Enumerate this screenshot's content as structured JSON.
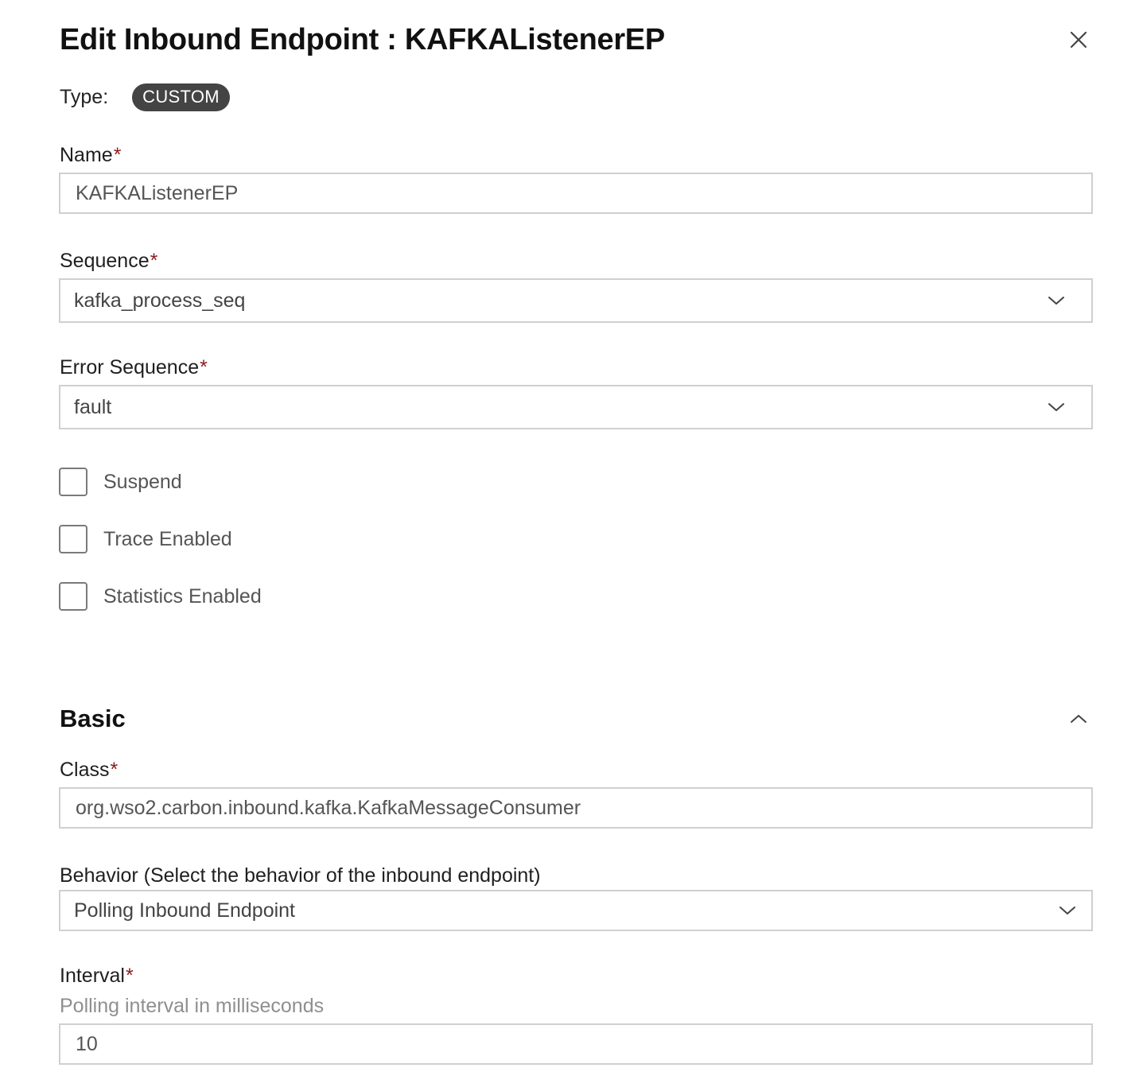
{
  "dialog": {
    "title": "Edit Inbound Endpoint : KAFKAListenerEP",
    "close_icon": "close-icon"
  },
  "type": {
    "label": "Type:",
    "value": "CUSTOM"
  },
  "fields": {
    "name": {
      "label": "Name",
      "required_mark": "*",
      "value": "KAFKAListenerEP"
    },
    "sequence": {
      "label": "Sequence",
      "required_mark": "*",
      "value": "kafka_process_seq"
    },
    "error_sequence": {
      "label": "Error Sequence",
      "required_mark": "*",
      "value": "fault"
    }
  },
  "checkboxes": {
    "suspend": {
      "label": "Suspend",
      "checked": false
    },
    "trace": {
      "label": "Trace Enabled",
      "checked": false
    },
    "statistics": {
      "label": "Statistics Enabled",
      "checked": false
    }
  },
  "basic": {
    "title": "Basic",
    "expanded": true,
    "class": {
      "label": "Class",
      "required_mark": "*",
      "value": "org.wso2.carbon.inbound.kafka.KafkaMessageConsumer"
    },
    "behavior": {
      "label": "Behavior (Select the behavior of the inbound endpoint)",
      "value": "Polling Inbound Endpoint"
    },
    "interval": {
      "label": "Interval",
      "required_mark": "*",
      "hint": "Polling interval in milliseconds",
      "value": "10"
    }
  },
  "colors": {
    "badge_bg": "#444444",
    "required": "#8b1a1a",
    "border": "#d0d0d0"
  }
}
